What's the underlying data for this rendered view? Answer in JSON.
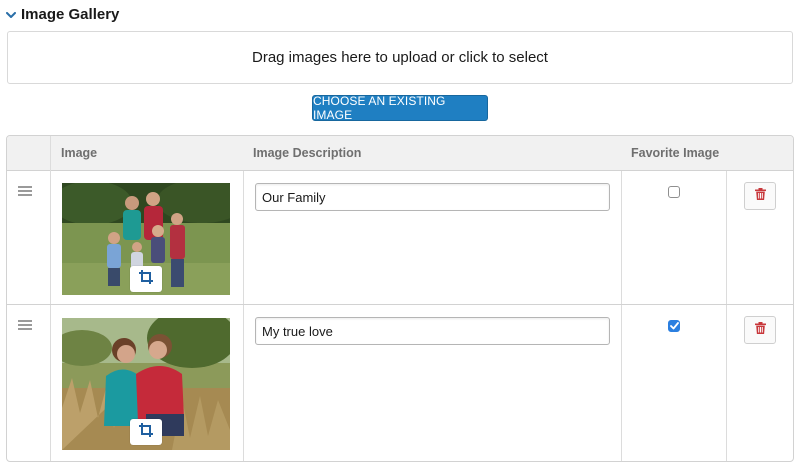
{
  "section": {
    "title": "Image Gallery",
    "toggle_icon": "chevron-down-icon"
  },
  "dropzone": {
    "text": "Drag images here to upload or click to select"
  },
  "choose_button": {
    "label": "CHOOSE AN EXISTING IMAGE"
  },
  "table": {
    "headers": {
      "image": "Image",
      "description": "Image Description",
      "favorite": "Favorite Image"
    },
    "rows": [
      {
        "photo": "family-photo",
        "description": "Our Family",
        "favorite": false
      },
      {
        "photo": "couple-photo",
        "description": "My true love",
        "favorite": true
      }
    ]
  },
  "colors": {
    "accent": "#1f7fc2",
    "checkbox_checked": "#2b7fe0",
    "delete_icon": "#c8373b",
    "header_bg": "#f1f1f1"
  },
  "icons": {
    "drag": "drag-handle-icon",
    "crop": "crop-icon",
    "delete": "trash-icon"
  }
}
